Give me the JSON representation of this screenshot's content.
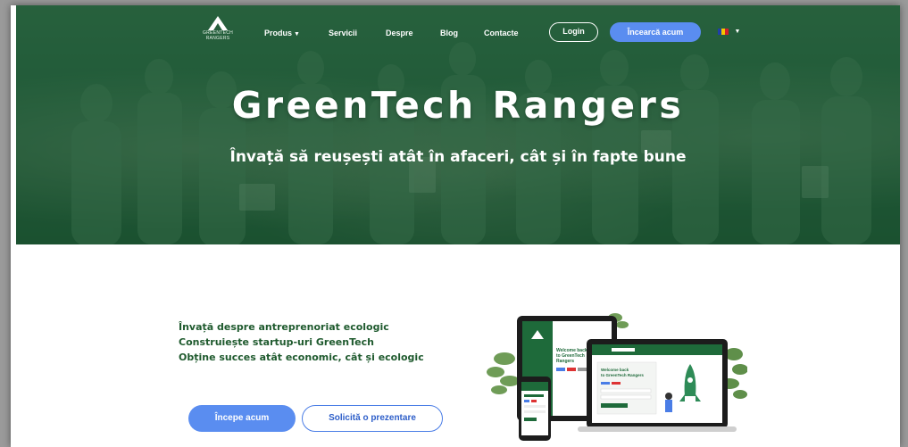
{
  "brand": {
    "logo_text_line1": "GREENTECH",
    "logo_text_line2": "RANGERS"
  },
  "nav": {
    "items": [
      {
        "label": "Produs",
        "has_dropdown": true
      },
      {
        "label": "Servicii"
      },
      {
        "label": "Despre"
      },
      {
        "label": "Blog"
      },
      {
        "label": "Contacte"
      }
    ],
    "login_label": "Login",
    "try_label": "Încearcă acum",
    "language": "ro"
  },
  "hero": {
    "title": "GreenTech Rangers",
    "subtitle": "Învață să reușești atât în afaceri, cât și în fapte bune"
  },
  "content": {
    "bullets": [
      "Învață despre antreprenoriat ecologic",
      "Construiește startup-uri GreenTech",
      "Obține succes atât economic, cât și ecologic"
    ],
    "primary_button": "Începe acum",
    "secondary_button": "Solicită o prezentare"
  },
  "mockup": {
    "tablet_heading": "Welcome back to GreenTech Rangers",
    "laptop_heading": "Welcome back to GreenTech Rangers"
  },
  "colors": {
    "hero_overlay": "#1e6a3a",
    "accent_blue": "#5a8df0",
    "bullet_green": "#1f5a2e"
  }
}
